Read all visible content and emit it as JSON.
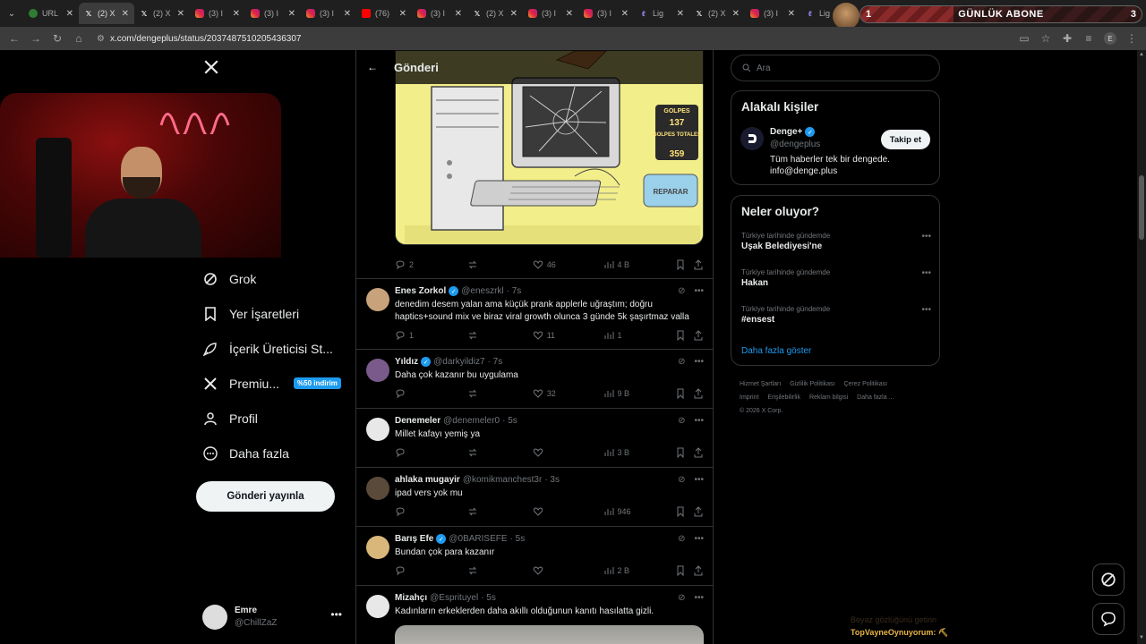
{
  "browser": {
    "tabs": [
      {
        "icon": "green-icon",
        "title": "URL"
      },
      {
        "icon": "x-icon",
        "title": "(2) X"
      },
      {
        "icon": "x-icon",
        "title": "(2) X"
      },
      {
        "icon": "instagram-icon",
        "title": "(3) I"
      },
      {
        "icon": "instagram-icon",
        "title": "(3) I"
      },
      {
        "icon": "instagram-icon",
        "title": "(3) I"
      },
      {
        "icon": "youtube-icon",
        "title": "(76)"
      },
      {
        "icon": "instagram-icon",
        "title": "(3) I"
      },
      {
        "icon": "x-icon",
        "title": "(2) X"
      },
      {
        "icon": "instagram-icon",
        "title": "(3) I"
      },
      {
        "icon": "instagram-icon",
        "title": "(3) I"
      },
      {
        "icon": "light-icon",
        "title": "Lig"
      },
      {
        "icon": "x-icon",
        "title": "(2) X"
      },
      {
        "icon": "instagram-icon",
        "title": "(3) I"
      },
      {
        "icon": "light-icon",
        "title": "Lig"
      }
    ],
    "url": "x.com/dengeplus/status/2037487510205436307",
    "profile_initial": "E"
  },
  "subscriber_goal": {
    "label": "GÜNLÜK ABONE",
    "current": "1",
    "target": "3",
    "progress": 0.33
  },
  "sidebar": {
    "items": [
      {
        "label": "Grok",
        "icon": "grok-icon"
      },
      {
        "label": "Yer İşaretleri",
        "icon": "bookmark-icon"
      },
      {
        "label": "İçerik Üreticisi St...",
        "icon": "rocket-icon"
      },
      {
        "label": "Premiu...",
        "icon": "x-icon",
        "badge": "%50 indirim"
      },
      {
        "label": "Profil",
        "icon": "person-icon"
      },
      {
        "label": "Daha fazla",
        "icon": "more-circle-icon"
      }
    ],
    "post_button": "Gönderi yayınla",
    "account": {
      "name": "Emre",
      "handle": "@ChillZaZ"
    }
  },
  "header": {
    "title": "Gönderi"
  },
  "main_post_stats": {
    "replies": "2",
    "likes": "46",
    "views": "4 B"
  },
  "image_labels": {
    "golpes": "GOLPES",
    "golpes_value": "137",
    "golpes_totales": "GOLPES\nTOTALES",
    "golpes_totales_value": "359",
    "reparar": "REPARAR"
  },
  "replies": [
    {
      "name": "Enes Zorkol",
      "verified": true,
      "handle": "@eneszrkl",
      "time": "· 7s",
      "text": "denedim desem yalan ama küçük prank applerle uğraştım; doğru haptics+sound mix ve biraz viral growth olunca 3 günde 5k şaşırtmaz valla",
      "replies": "1",
      "likes": "11",
      "views": "1"
    },
    {
      "name": "Yıldız",
      "verified": true,
      "handle": "@darkyildiz7",
      "time": "· 7s",
      "text": "Daha çok kazanır bu uygulama",
      "replies": "",
      "likes": "32",
      "views": "9 B"
    },
    {
      "name": "Denemeler",
      "verified": false,
      "handle": "@denemeler0",
      "time": "· 5s",
      "text": "Millet kafayı yemiş ya",
      "replies": "",
      "likes": "",
      "views": "3 B"
    },
    {
      "name": "ahlaka mugayir",
      "verified": false,
      "handle": "@komikmanchest3r",
      "time": "· 3s",
      "text": "ipad vers yok mu",
      "replies": "",
      "likes": "",
      "views": "946"
    },
    {
      "name": "Barış Efe",
      "verified": true,
      "handle": "@0BARISEFE",
      "time": "· 5s",
      "text": "Bundan çok para kazanır",
      "replies": "",
      "likes": "",
      "views": "2 B"
    },
    {
      "name": "Mizahçı",
      "verified": false,
      "handle": "@Esprituyel",
      "time": "· 5s",
      "text": "Kadınların erkeklerden daha akıllı olduğunun kanıtı hasılatta gizli.",
      "replies": "",
      "likes": "",
      "views": ""
    }
  ],
  "right": {
    "search_placeholder": "Ara",
    "related_title": "Alakalı kişiler",
    "related": {
      "name": "Denge+",
      "handle": "@dengeplus",
      "bio": "Tüm haberler tek bir dengede. info@denge.plus",
      "follow_label": "Takip et"
    },
    "trends_title": "Neler oluyor?",
    "trends": [
      {
        "meta": "Türkiye tarihinde gündemde",
        "name": "Uşak Belediyesi'ne"
      },
      {
        "meta": "Türkiye tarihinde gündemde",
        "name": "Hakan"
      },
      {
        "meta": "Türkiye tarihinde gündemde",
        "name": "#ensest"
      }
    ],
    "show_more": "Daha fazla göster",
    "footer_links": [
      "Hizmet Şartları",
      "Gizlilik Politikası",
      "Çerez Politikası",
      "Imprint",
      "Erişilebilirlik",
      "Reklam bilgisi",
      "Daha fazla ...",
      "© 2026 X Corp."
    ]
  },
  "stream_overlay": {
    "chat_line_dim": "Beyaz gözlüğünü getirin",
    "chat_line": "TopVayneOynuyorum:"
  }
}
